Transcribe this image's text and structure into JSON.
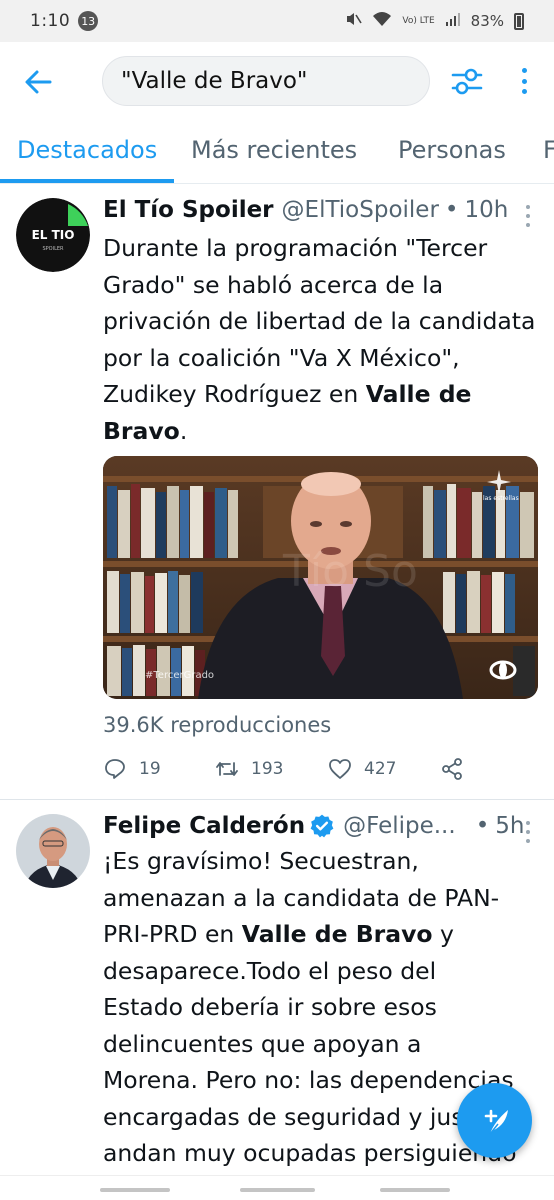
{
  "status_bar": {
    "time": "1:10",
    "notification_count": "13",
    "network": "Vo) LTE",
    "battery": "83%"
  },
  "search": {
    "query": "\"Valle de Bravo\""
  },
  "tabs": [
    {
      "label": "Destacados",
      "active": true
    },
    {
      "label": "Más recientes",
      "active": false
    },
    {
      "label": "Personas",
      "active": false
    },
    {
      "label": "F",
      "active": false
    }
  ],
  "tweets": [
    {
      "display_name": "El Tío Spoiler",
      "handle": "@ElTioSpoiler",
      "dot": "•",
      "time": "10h",
      "avatar_text": "EL TIO",
      "avatar_subtext": "SPOILER",
      "text_before": "Durante la programación \"Tercer Grado\" se habló acerca de la privación de libertad de la candidata por la coalición \"Va X México\", Zudikey Rodríguez en ",
      "text_bold": "Valle de Bravo",
      "text_after": ".",
      "media_watermark": "Tío So",
      "media_hashtag": "#TercerGrado",
      "media_brand": "las estrellas",
      "views": "39.6K reproducciones",
      "replies": "19",
      "retweets": "193",
      "likes": "427"
    },
    {
      "display_name": "Felipe Calderón",
      "handle": "@Felipe...",
      "dot": "•",
      "time": "5h",
      "verified": true,
      "text_part1": "¡Es gravísimo! Secuestran, amenazan a la candidata de PAN-PRI-PRD en ",
      "text_bold": "Valle de Bravo",
      "text_part2": " y desaparece.Todo el peso del Estado debería ir sobre esos delincuentes que apoyan a Morena. Pero no: las dependencias encargadas de seguridad y justicia andan muy ocupadas persiguiendo opositores"
    }
  ],
  "colors": {
    "accent": "#1d9bf0",
    "text_primary": "#0f1419",
    "text_secondary": "#536471"
  }
}
